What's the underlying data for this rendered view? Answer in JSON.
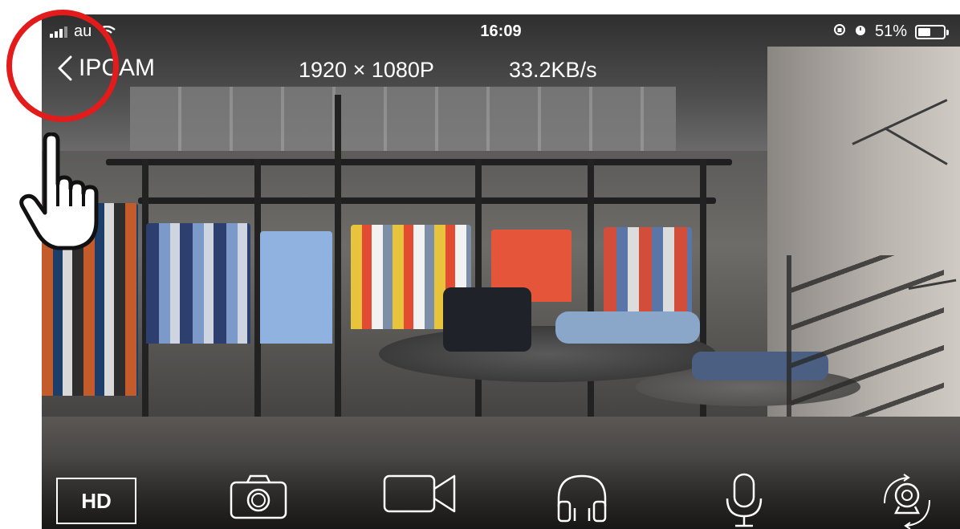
{
  "status_bar": {
    "carrier": "au",
    "time": "16:09",
    "battery_percent": "51%",
    "battery_level": 0.51,
    "icons": [
      "signal-icon",
      "wifi-icon",
      "rotation-lock-icon",
      "alarm-icon",
      "battery-icon"
    ]
  },
  "header": {
    "back_label": "IPCAM",
    "resolution": "1920 × 1080P",
    "bitrate": "33.2KB/s"
  },
  "toolbar": {
    "hd_label": "HD",
    "icons": [
      "camera-icon",
      "video-record-icon",
      "headphones-icon",
      "microphone-icon",
      "camera-rotate-icon"
    ]
  },
  "annotation": {
    "highlight_color": "#e41b1b",
    "pointer": "pointing-hand-icon"
  }
}
